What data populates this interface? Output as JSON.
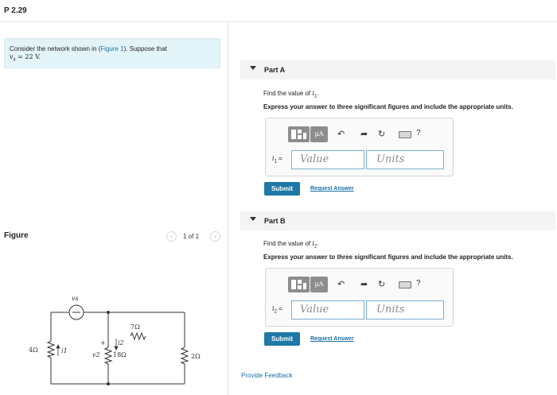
{
  "problem": {
    "id": "P 2.29"
  },
  "intro": {
    "before_link": "Consider the network shown in (",
    "link": "Figure 1",
    "after_link": "). Suppose that",
    "eq_var": "v",
    "eq_sub": "s",
    "eq_value": " = 22 V."
  },
  "figure": {
    "title": "Figure",
    "pager_text": "1 of 1",
    "prev_icon": "chevron-left-icon",
    "next_icon": "chevron-right-icon",
    "circuit": {
      "source_label": "vs",
      "r1": "4Ω",
      "r1_current": "i1",
      "r2": "7Ω",
      "r3": "18Ω",
      "r3_voltage": "v2",
      "r3_current": "i2",
      "r4": "2Ω",
      "plus": "+"
    }
  },
  "part_a": {
    "title": "Part A",
    "question_prefix": "Find the value of ",
    "question_var": "i",
    "question_sub": "1",
    "question_suffix": ".",
    "instruction": "Express your answer to three significant figures and include the appropriate units.",
    "var_label": "i",
    "var_sub": "1",
    "var_eq": " =",
    "value_placeholder": "Value",
    "units_placeholder": "Units",
    "submit": "Submit",
    "request": "Request Answer"
  },
  "part_b": {
    "title": "Part B",
    "question_prefix": "Find the value of ",
    "question_var": "i",
    "question_sub": "2",
    "question_suffix": ".",
    "instruction": "Express your answer to three significant figures and include the appropriate units.",
    "var_label": "i",
    "var_sub": "2",
    "var_eq": " =",
    "value_placeholder": "Value",
    "units_placeholder": "Units",
    "submit": "Submit",
    "request": "Request Answer"
  },
  "toolbar": {
    "mu_label": "μA",
    "help_label": "?",
    "icons": [
      "templates-icon",
      "units-icon",
      "undo-icon",
      "redo-icon",
      "reset-icon",
      "keyboard-icon",
      "help-icon"
    ]
  },
  "feedback": {
    "label": "Provide Feedback"
  },
  "colors": {
    "accent": "#1e78a6",
    "intro_bg": "#e3f4f8",
    "link": "#1a6fa8"
  }
}
